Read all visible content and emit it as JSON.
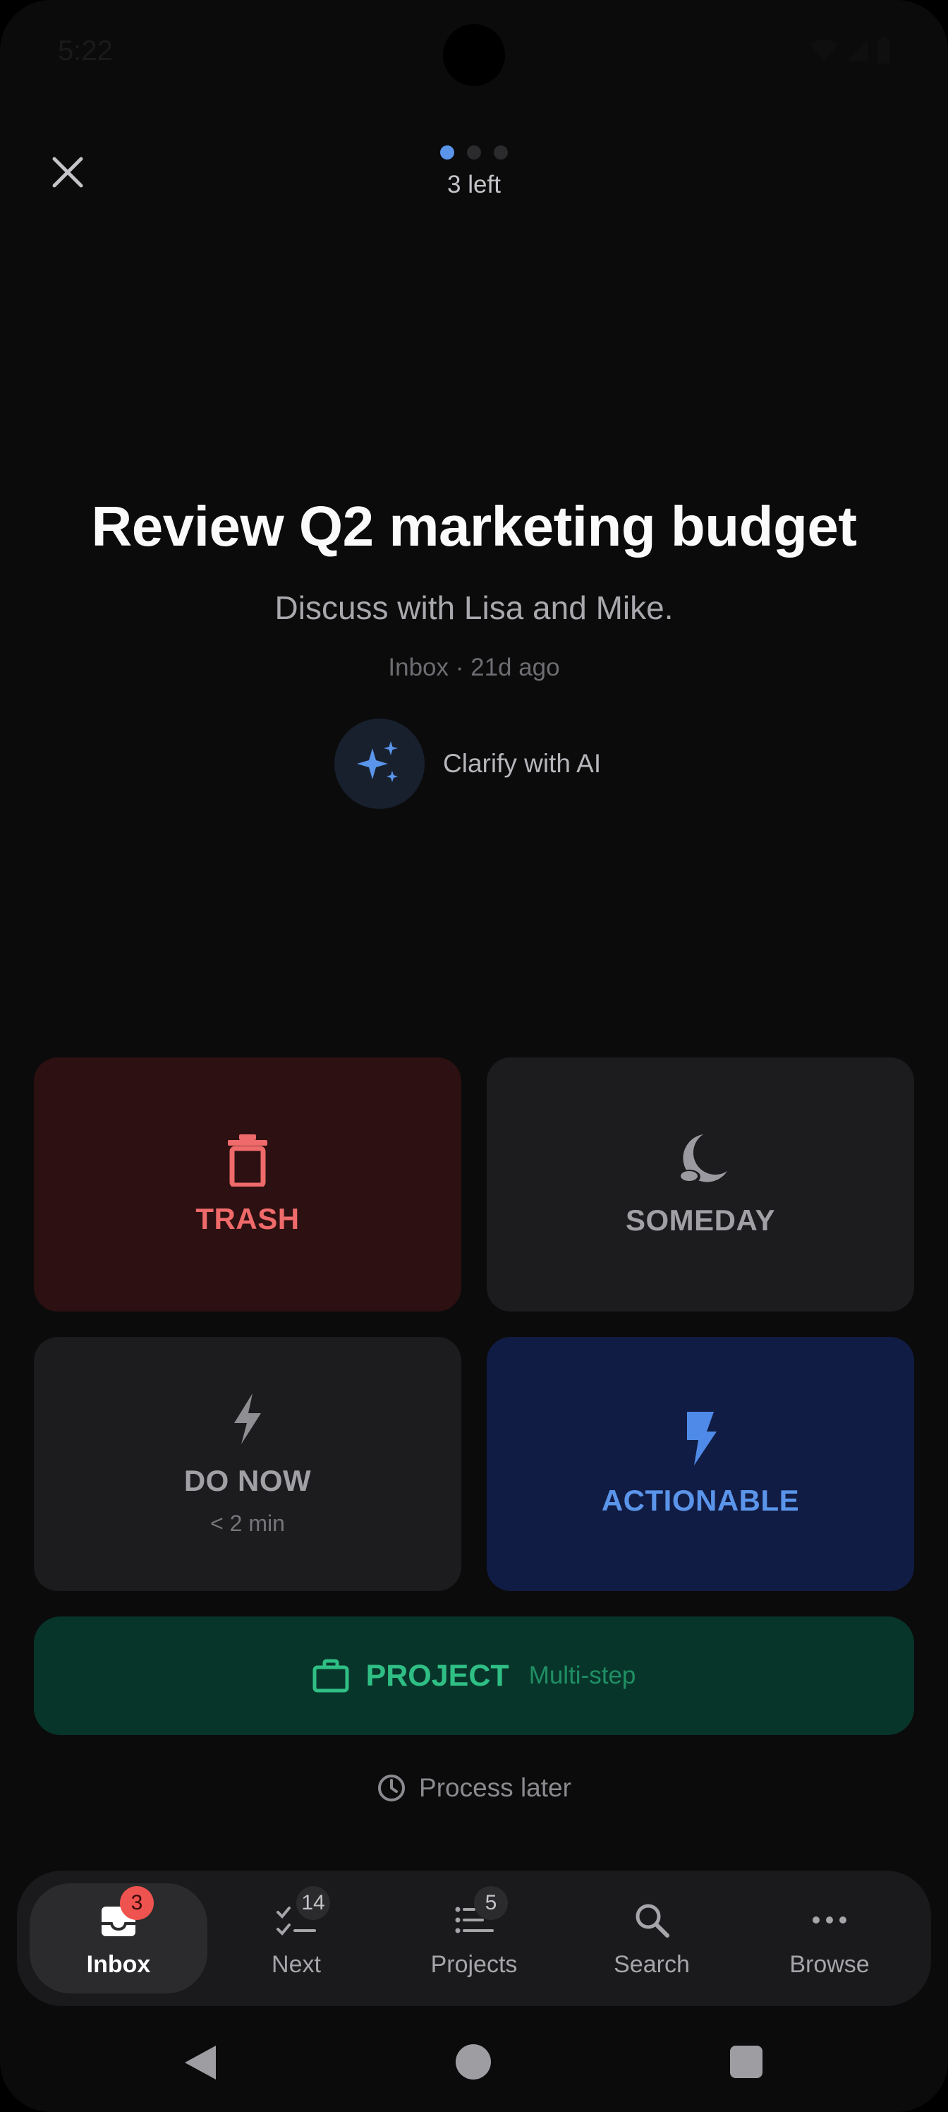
{
  "status_bar": {
    "time": "5:22"
  },
  "header": {
    "close_icon": "close-icon",
    "progress": {
      "total": 3,
      "current": 1
    },
    "remaining_text": "3 left"
  },
  "task": {
    "title": "Review Q2 marketing budget",
    "description": "Discuss with Lisa and Mike.",
    "meta": "Inbox · 21d ago",
    "ai_label": "Clarify with AI",
    "ai_icon": "sparkles-icon"
  },
  "actions": {
    "trash": {
      "label": "TRASH",
      "icon": "trash-icon",
      "color": "#ef6a6a"
    },
    "someday": {
      "label": "SOMEDAY",
      "icon": "moon-icon"
    },
    "do_now": {
      "label": "DO NOW",
      "sub": "< 2 min",
      "icon": "lightning-icon"
    },
    "actionable": {
      "label": "ACTIONABLE",
      "icon": "bolt-icon",
      "color": "#5a95ea"
    },
    "project": {
      "label": "PROJECT",
      "sub": "Multi-step",
      "icon": "briefcase-icon",
      "color": "#2fbf85"
    },
    "later": {
      "label": "Process later",
      "icon": "clock-icon"
    }
  },
  "nav": {
    "items": [
      {
        "label": "Inbox",
        "badge": "3",
        "icon": "inbox-icon",
        "active": true
      },
      {
        "label": "Next",
        "badge": "14",
        "icon": "checklist-icon"
      },
      {
        "label": "Projects",
        "badge": "5",
        "icon": "list-icon"
      },
      {
        "label": "Search",
        "icon": "search-icon"
      },
      {
        "label": "Browse",
        "icon": "more-icon"
      }
    ]
  }
}
